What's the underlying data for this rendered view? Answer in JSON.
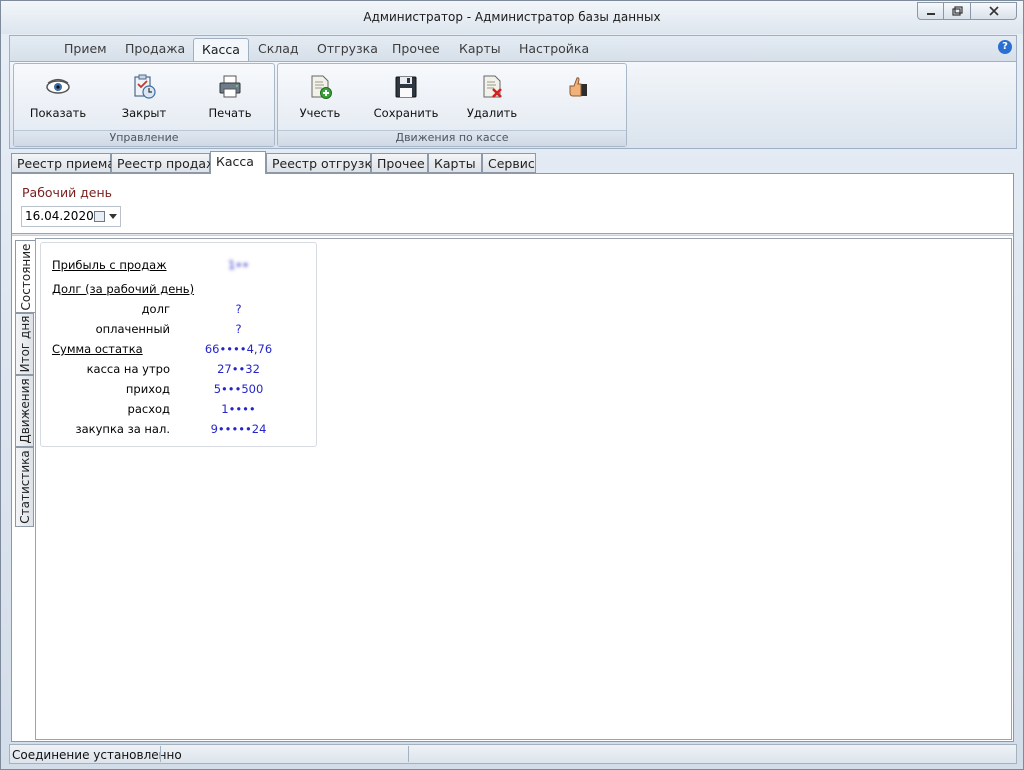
{
  "window": {
    "title": "Администратор - Администратор базы данных"
  },
  "ribbon": {
    "tabs": [
      "Прием",
      "Продажа",
      "Касса",
      "Склад",
      "Отгрузка",
      "Прочее",
      "Карты",
      "Настройка"
    ],
    "active_tab": "Касса",
    "groups": {
      "manage": {
        "label": "Управление",
        "buttons": {
          "show": "Показать",
          "close": "Закрыт",
          "print": "Печать"
        }
      },
      "cash": {
        "label": "Движения по кассе",
        "buttons": {
          "account": "Учесть",
          "save": "Сохранить",
          "delete": "Удалить",
          "approve": ""
        }
      }
    },
    "icons": {
      "show": "eye-icon",
      "close": "clipboard-check-icon",
      "print": "printer-icon",
      "account": "document-add-icon",
      "save": "floppy-disk-icon",
      "delete": "document-delete-icon",
      "approve": "thumbs-up-icon",
      "help": "help-icon"
    }
  },
  "doc_tabs": [
    "Реестр приема",
    "Реестр продаж",
    "Касса",
    "Реестр отгрузки",
    "Прочее",
    "Карты",
    "Сервис"
  ],
  "active_doc_tab": "Касса",
  "workday": {
    "label": "Рабочий день",
    "date": "16.04.2020"
  },
  "side_tabs": [
    "Состояние",
    "Итог дня",
    "Движения",
    "Статистика"
  ],
  "active_side_tab": "Состояние",
  "stats": {
    "profit_label": "Прибыль с продаж",
    "profit_value": "1••",
    "debt_header": "Долг (за рабочий день)",
    "debt_label": "долг",
    "debt_value": "?",
    "paid_label": "оплаченный",
    "paid_value": "?",
    "balance_label": "Сумма остатка",
    "balance_value": "66••••4,76",
    "morning_label": "касса на утро",
    "morning_value": "27••32",
    "income_label": "приход",
    "income_value": "5•••500",
    "expense_label": "расход",
    "expense_value": "1••••",
    "purchase_label": "закупка за нал.",
    "purchase_value": "9•••••24"
  },
  "status": {
    "text": "Соединение установленно"
  },
  "colors": {
    "value_blue": "#2626c8",
    "workday_label": "#7a1f1f"
  }
}
